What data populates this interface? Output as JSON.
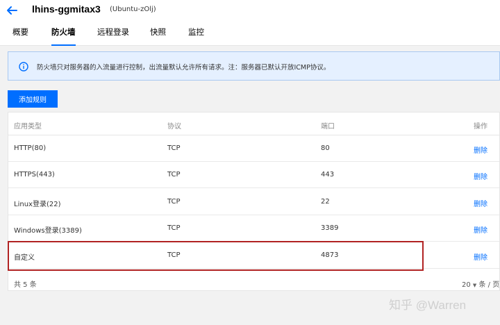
{
  "header": {
    "instance_name": "lhins-ggmitax3",
    "instance_subtitle": "(Ubuntu-zOlj)"
  },
  "tabs": [
    {
      "label": "概要"
    },
    {
      "label": "防火墙",
      "active": true
    },
    {
      "label": "远程登录"
    },
    {
      "label": "快照"
    },
    {
      "label": "监控"
    }
  ],
  "notice": {
    "text": "防火墙只对服务器的入流量进行控制，出流量默认允许所有请求。注：服务器已默认开放ICMP协议。"
  },
  "toolbar": {
    "add_rule_label": "添加规则"
  },
  "table": {
    "columns": [
      "应用类型",
      "协议",
      "端口",
      "操作"
    ],
    "rows": [
      {
        "app": "HTTP(80)",
        "protocol": "TCP",
        "port": "80",
        "action": "删除"
      },
      {
        "app": "HTTPS(443)",
        "protocol": "TCP",
        "port": "443",
        "action": "删除"
      },
      {
        "app": "Linux登录(22)",
        "protocol": "TCP",
        "port": "22",
        "action": "删除"
      },
      {
        "app": "Windows登录(3389)",
        "protocol": "TCP",
        "port": "3389",
        "action": "删除"
      },
      {
        "app": "自定义",
        "protocol": "TCP",
        "port": "4873",
        "action": "删除"
      }
    ],
    "total_text": "共 5 条",
    "page_size": "20",
    "page_size_suffix": "条 / 页"
  },
  "watermark": "知乎 @Warren",
  "colors": {
    "accent": "#006eff",
    "notice_bg": "#e5f0ff",
    "highlight_border": "#b12222"
  }
}
